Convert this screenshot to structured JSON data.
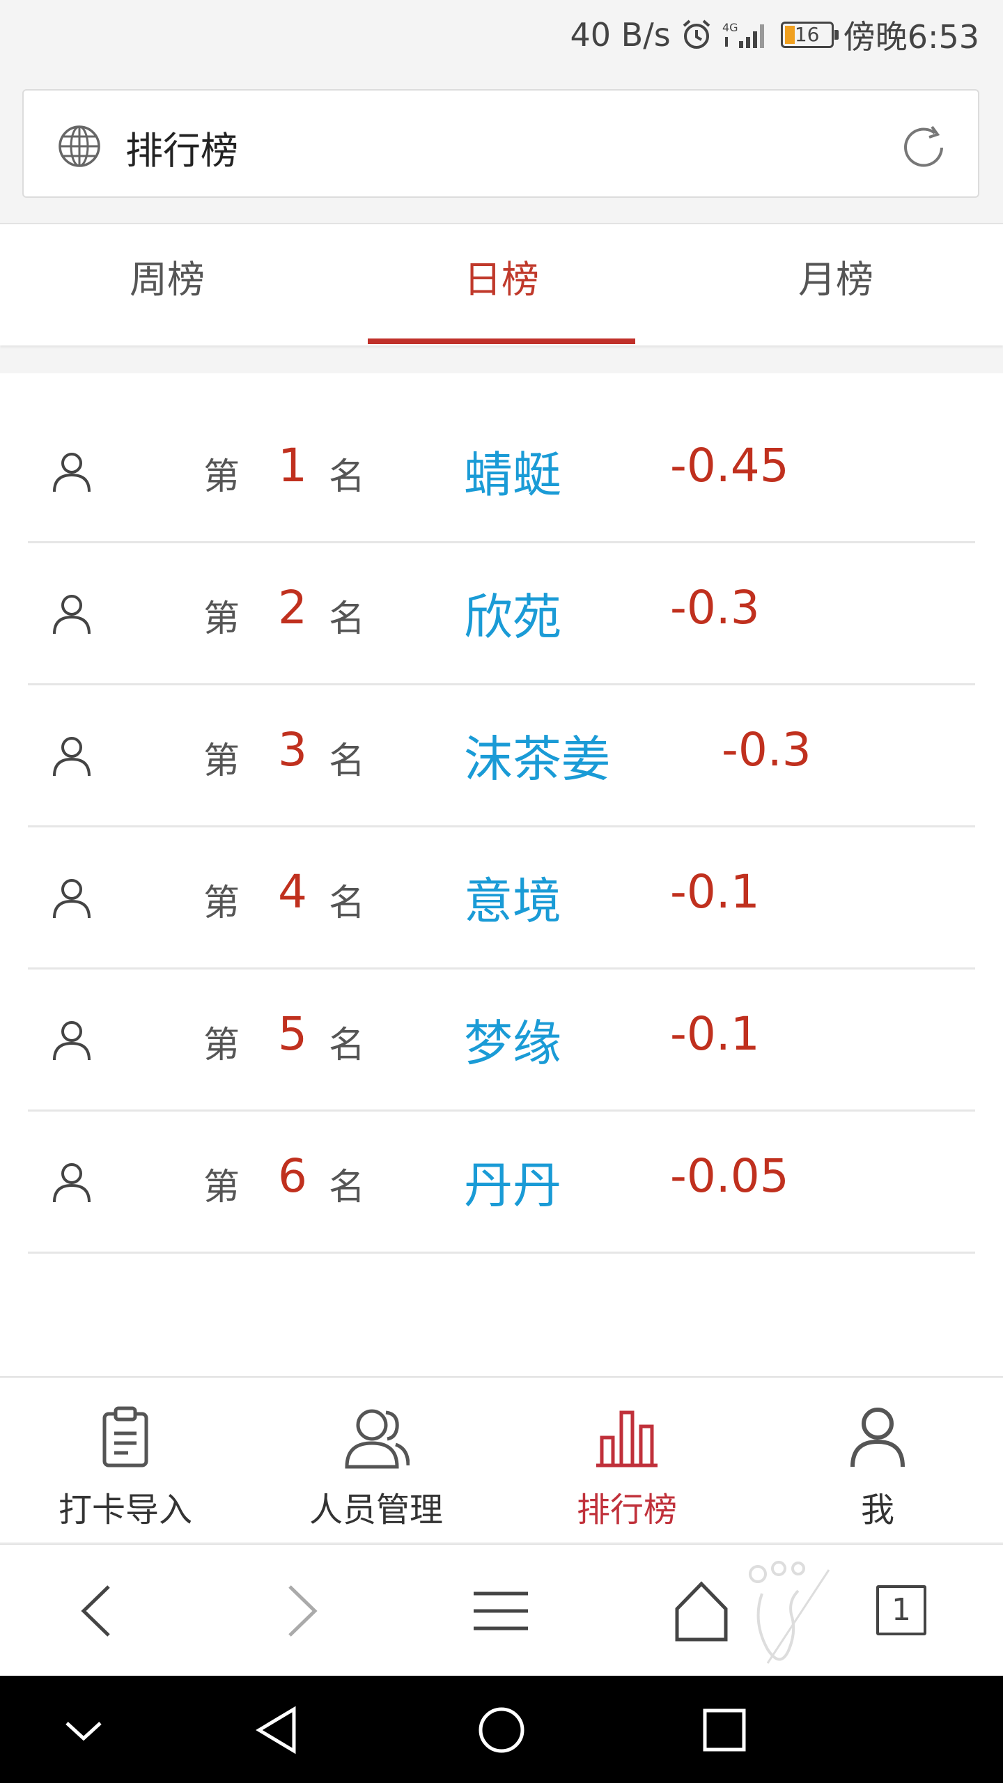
{
  "status_bar": {
    "net_speed": "40 B/s",
    "battery": "16",
    "time": "傍晚6:53"
  },
  "address_bar": {
    "title": "排行榜"
  },
  "tabs": [
    {
      "label": "周榜",
      "active": false
    },
    {
      "label": "日榜",
      "active": true
    },
    {
      "label": "月榜",
      "active": false
    }
  ],
  "ranking": {
    "prefix": "第",
    "suffix": "名",
    "rows": [
      {
        "rank": "1",
        "name": "蜻蜓",
        "score": "-0.45"
      },
      {
        "rank": "2",
        "name": "欣苑",
        "score": "-0.3"
      },
      {
        "rank": "3",
        "name": "沫茶姜",
        "score": "-0.3"
      },
      {
        "rank": "4",
        "name": "意境",
        "score": "-0.1"
      },
      {
        "rank": "5",
        "name": "梦缘",
        "score": "-0.1"
      },
      {
        "rank": "6",
        "name": "丹丹",
        "score": "-0.05"
      }
    ]
  },
  "bottom_nav": [
    {
      "label": "打卡导入",
      "icon": "clipboard-icon"
    },
    {
      "label": "人员管理",
      "icon": "people-icon"
    },
    {
      "label": "排行榜",
      "icon": "bar-chart-icon",
      "active": true
    },
    {
      "label": "我",
      "icon": "person-icon"
    }
  ],
  "browser_bar": {
    "tab_count": "1"
  },
  "colors": {
    "accent_red": "#c0302a",
    "name_blue": "#1a9bd6"
  }
}
